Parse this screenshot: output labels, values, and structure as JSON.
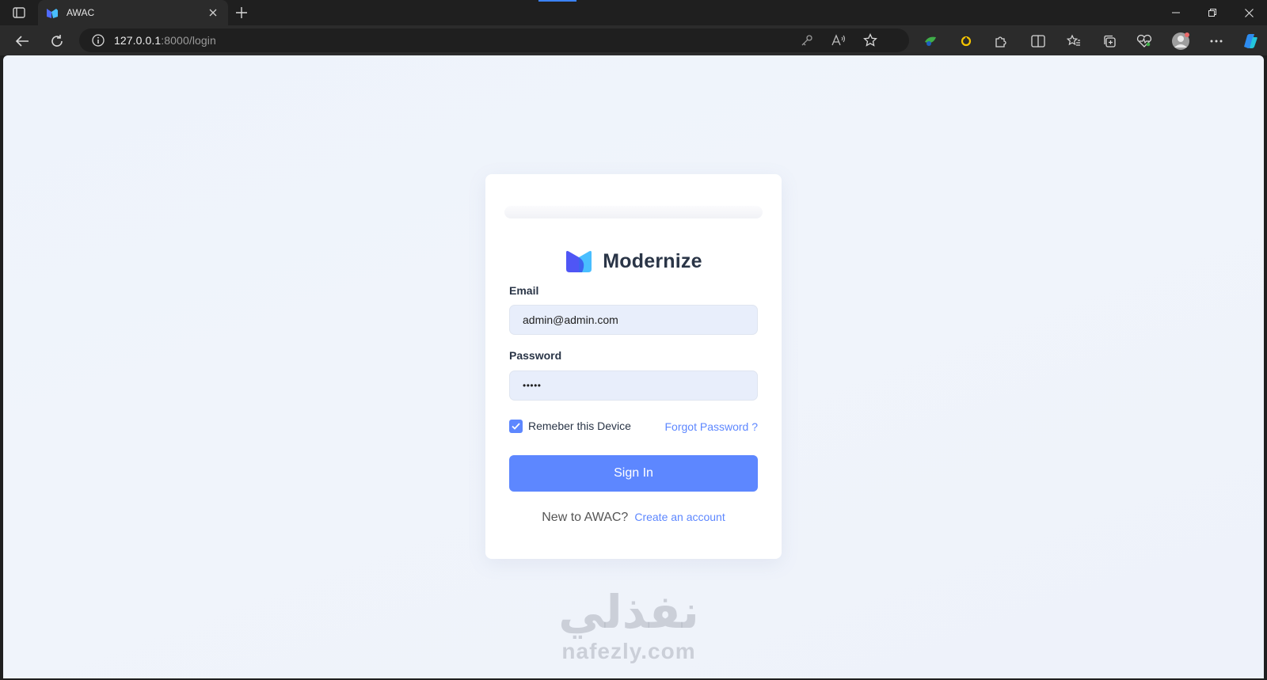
{
  "browser": {
    "tab": {
      "title": "AWAC"
    },
    "url": {
      "host": "127.0.0.1",
      "path": ":8000/login"
    }
  },
  "login": {
    "brand_name": "Modernize",
    "email_label": "Email",
    "email_value": "admin@admin.com",
    "password_label": "Password",
    "password_value": "•••••",
    "remember_label": "Remeber this Device",
    "forgot_label": "Forgot Password ?",
    "signin_label": "Sign In",
    "new_user_text": "New to AWAC?",
    "create_account_label": "Create an account"
  },
  "watermark": {
    "arabic": "نفذلي",
    "latin": "nafezly.com"
  },
  "colors": {
    "accent": "#5d87ff",
    "heading": "#2a3547",
    "field_bg": "#e8eefb",
    "page_bg": "#eef3fb"
  }
}
